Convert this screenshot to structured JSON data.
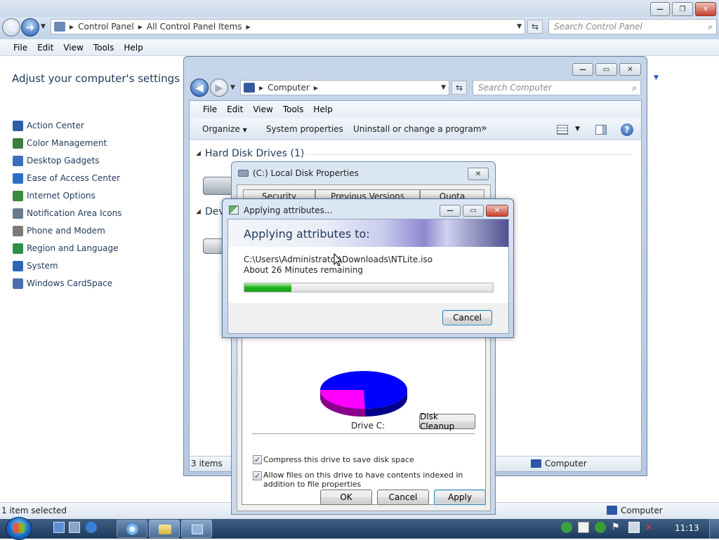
{
  "control_panel": {
    "breadcrumb": [
      "Control Panel",
      "All Control Panel Items"
    ],
    "search_placeholder": "Search Control Panel",
    "menu": [
      "File",
      "Edit",
      "View",
      "Tools",
      "Help"
    ],
    "heading": "Adjust your computer's settings",
    "items": [
      {
        "label": "Action Center",
        "icon": "flag-icon",
        "color": "#2a5fa8"
      },
      {
        "label": "Color Management",
        "icon": "color-management-icon",
        "color": "#3b7d3b"
      },
      {
        "label": "Desktop Gadgets",
        "icon": "gadgets-icon",
        "color": "#3d6fb8"
      },
      {
        "label": "Ease of Access Center",
        "icon": "ease-of-access-icon",
        "color": "#2b70c8"
      },
      {
        "label": "Internet Options",
        "icon": "globe-icon",
        "color": "#3b8a3b"
      },
      {
        "label": "Notification Area Icons",
        "icon": "notification-icon",
        "color": "#6a7b8c"
      },
      {
        "label": "Phone and Modem",
        "icon": "phone-icon",
        "color": "#7a7a7a"
      },
      {
        "label": "Region and Language",
        "icon": "region-icon",
        "color": "#2c8f4a"
      },
      {
        "label": "System",
        "icon": "system-icon",
        "color": "#3165b3"
      },
      {
        "label": "Windows CardSpace",
        "icon": "cardspace-icon",
        "color": "#4a6fb0"
      }
    ],
    "status": "1 item selected",
    "status_right": "Computer"
  },
  "computer": {
    "breadcrumb": "Computer",
    "search_placeholder": "Search Computer",
    "menu": [
      "File",
      "Edit",
      "View",
      "Tools",
      "Help"
    ],
    "toolbar": {
      "organize": "Organize",
      "system_properties": "System properties",
      "uninstall": "Uninstall or change a program",
      "more": "»"
    },
    "hdd_group": "Hard Disk Drives (1)",
    "dev_group": "Dev",
    "status_left": "3 items",
    "status_right": "Computer"
  },
  "disk_props": {
    "title": "(C:) Local Disk Properties",
    "tabs": [
      "Security",
      "Previous Versions",
      "Quota"
    ],
    "drive_label": "Drive C:",
    "disk_cleanup": "Disk Cleanup",
    "compress_label": "Compress this drive to save disk space",
    "index_label": "Allow files on this drive to have contents indexed in addition to file properties",
    "ok": "OK",
    "cancel": "Cancel",
    "apply": "Apply",
    "pie": {
      "used_fraction": 0.28,
      "used_color": "#ff00ff",
      "free_color": "#0000ff"
    }
  },
  "apply_dialog": {
    "title": "Applying attributes...",
    "heading": "Applying attributes to:",
    "path": "C:\\Users\\Administrator\\Downloads\\NTLite.iso",
    "remaining": "About 26 Minutes remaining",
    "progress": 0.19,
    "cancel": "Cancel"
  },
  "taskbar": {
    "clock": "11:13",
    "accent": "#1c3a5e"
  }
}
